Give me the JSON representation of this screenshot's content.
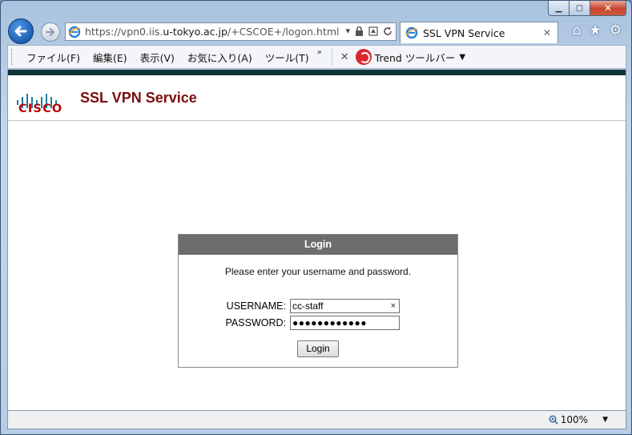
{
  "window": {
    "minimize": "▁",
    "maximize": "▢",
    "close": "✕"
  },
  "nav": {
    "url_prefix": "https://vpn0.iis.",
    "url_host": "u-tokyo.ac.jp",
    "url_path": "/+CSCOE+/logon.html",
    "tab_title": "SSL VPN Service",
    "tab_close": "✕"
  },
  "toolbar": {
    "menus": [
      "ファイル(F)",
      "編集(E)",
      "表示(V)",
      "お気に入り(A)",
      "ツール(T)"
    ],
    "overflow": "»",
    "close_x": "✕",
    "trend_label": "Trend ツールバー",
    "trend_arrow": "▼"
  },
  "icons": {
    "home": "⌂",
    "favorites": "★",
    "settings": "⚙"
  },
  "page": {
    "logo_text": "CISCO",
    "title": "SSL VPN Service"
  },
  "login": {
    "heading": "Login",
    "message": "Please enter your username and password.",
    "username_label": "USERNAME:",
    "username_value": "cc-staff",
    "clear": "×",
    "password_label": "PASSWORD:",
    "password_value": "●●●●●●●●●●●●",
    "button": "Login"
  },
  "status": {
    "zoom": "100%",
    "zoom_arrow": "▼"
  },
  "colors": {
    "brand_red": "#b30707",
    "title_red": "#7b0d0d",
    "header_strip": "#0f3637",
    "login_header": "#6d6d6d"
  }
}
